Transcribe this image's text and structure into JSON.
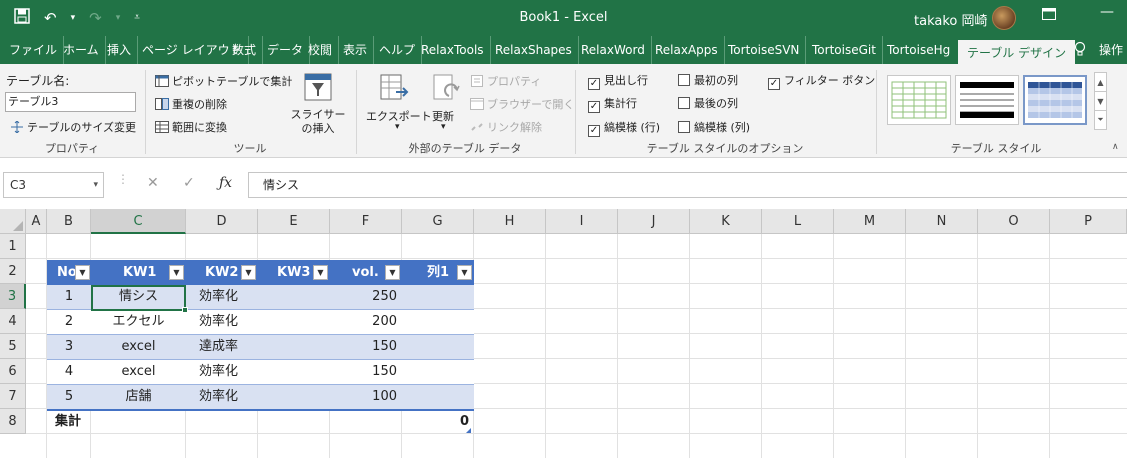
{
  "app": {
    "doc_title": "Book1 - Excel",
    "user_name": "takako 岡崎"
  },
  "tabs": [
    "ファイル",
    "ホーム",
    "挿入",
    "ページ レイアウト",
    "数式",
    "データ",
    "校閲",
    "表示",
    "ヘルプ",
    "RelaxTools",
    "RelaxShapes",
    "RelaxWord",
    "RelaxApps",
    "TortoiseSVN",
    "TortoiseGit",
    "TortoiseHg",
    "テーブル デザイン",
    "操作"
  ],
  "active_tab": "テーブル デザイン",
  "ribbon": {
    "properties": {
      "label": "テーブル名:",
      "name_value": "テーブル3",
      "resize": "テーブルのサイズ変更",
      "group": "プロパティ"
    },
    "tools": {
      "pivot": "ピボットテーブルで集計",
      "remove_dup": "重複の削除",
      "convert": "範囲に変換",
      "slicer": "スライサーの挿入",
      "group": "ツール"
    },
    "external": {
      "export": "エクスポート",
      "refresh": "更新",
      "properties": "プロパティ",
      "browser": "ブラウザーで開く",
      "unlink": "リンク解除",
      "group": "外部のテーブル データ"
    },
    "options": {
      "header_row": {
        "label": "見出し行",
        "checked": true
      },
      "total_row": {
        "label": "集計行",
        "checked": true
      },
      "banded_rows": {
        "label": "縞模様 (行)",
        "checked": true
      },
      "first_column": {
        "label": "最初の列",
        "checked": false
      },
      "last_column": {
        "label": "最後の列",
        "checked": false
      },
      "banded_columns": {
        "label": "縞模様 (列)",
        "checked": false
      },
      "filter_button": {
        "label": "フィルター ボタン",
        "checked": true
      },
      "group": "テーブル スタイルのオプション"
    },
    "styles": {
      "group": "テーブル スタイル"
    }
  },
  "formula_bar": {
    "name_box": "C3",
    "formula": "情シス"
  },
  "columns": [
    "A",
    "B",
    "C",
    "D",
    "E",
    "F",
    "G",
    "H",
    "I",
    "J",
    "K",
    "L",
    "M",
    "N",
    "O",
    "P"
  ],
  "rows": [
    "1",
    "2",
    "3",
    "4",
    "5",
    "6",
    "7",
    "8"
  ],
  "table": {
    "headers": [
      "No",
      "KW1",
      "KW2",
      "KW3",
      "vol.",
      "列1"
    ],
    "rows": [
      [
        "1",
        "情シス",
        "効率化",
        "",
        "250",
        ""
      ],
      [
        "2",
        "エクセル",
        "効率化",
        "",
        "200",
        ""
      ],
      [
        "3",
        "excel",
        "達成率",
        "",
        "150",
        ""
      ],
      [
        "4",
        "excel",
        "効率化",
        "",
        "150",
        ""
      ],
      [
        "5",
        "店舗",
        "効率化",
        "",
        "100",
        ""
      ]
    ],
    "total_label": "集計",
    "total_value": "0"
  },
  "colors": {
    "excel_green": "#217346",
    "table_header": "#4472c4",
    "band": "#d9e1f2"
  }
}
